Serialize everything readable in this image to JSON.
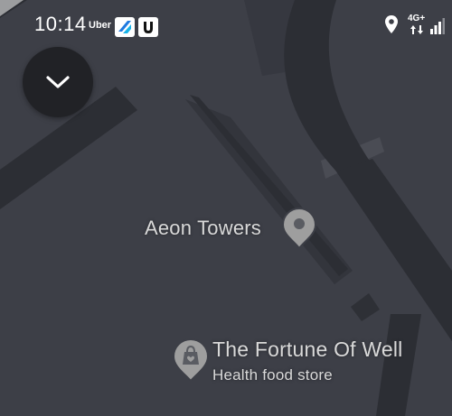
{
  "status_bar": {
    "time": "10:14",
    "uber_label": "Uber",
    "app_icon_1": "blue-app-icon",
    "app_icon_2": "u-app-icon",
    "location_icon": "location-pin-icon",
    "network_label": "4G+",
    "signal_icon": "signal-strength-icon"
  },
  "controls": {
    "collapse_button_icon": "chevron-down-icon"
  },
  "places": [
    {
      "name": "Aeon Towers",
      "icon": "place-pin-icon"
    },
    {
      "name": "The Fortune Of Well",
      "category": "Health food store",
      "icon": "shopping-bag-pin-icon"
    }
  ],
  "colors": {
    "map_background": "#3d3f47",
    "road": "#2c2e34",
    "building": "#33353c",
    "label": "#d9d9d9",
    "pin": "#9e9e9e",
    "button_background": "#212226"
  }
}
